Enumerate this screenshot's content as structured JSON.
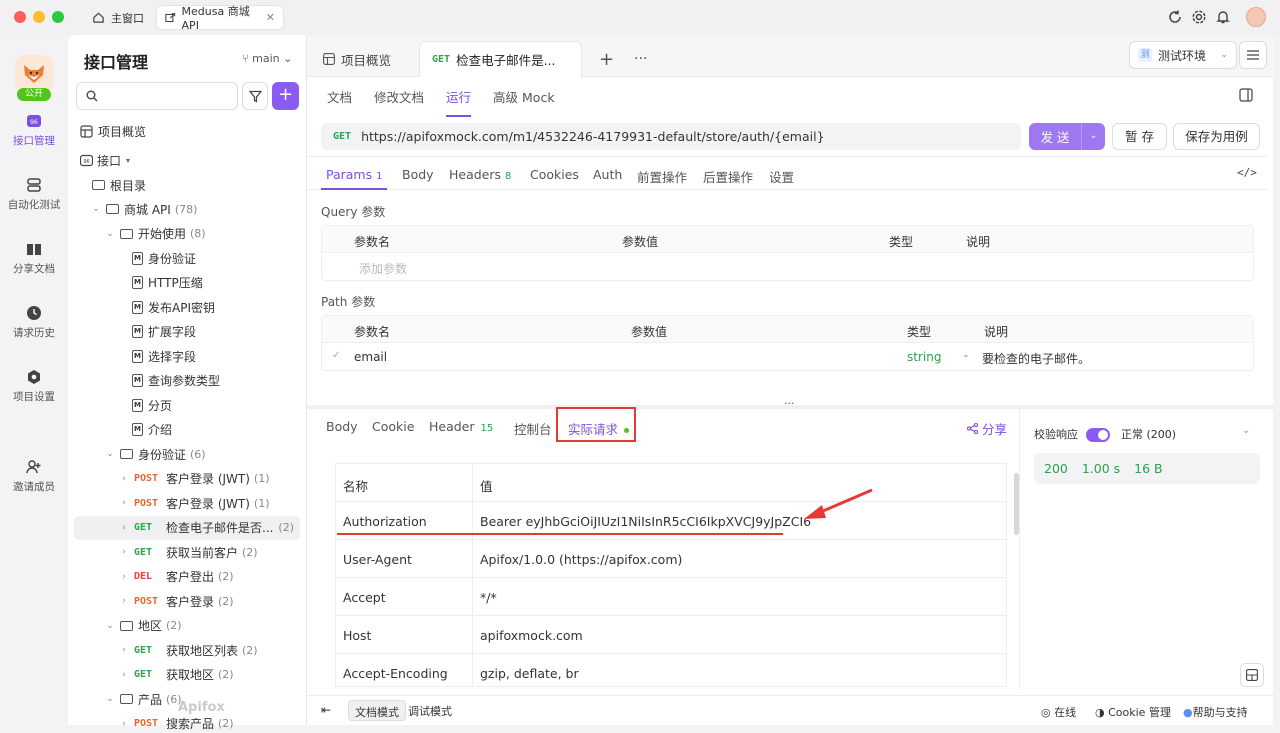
{
  "titlebar": {
    "home_tab": "主窗口",
    "project_tab": "Medusa 商城 API",
    "close": "✕"
  },
  "rail": {
    "public_badge": "公开",
    "items": [
      {
        "label": "接口管理",
        "icon": "api-icon"
      },
      {
        "label": "自动化测试",
        "icon": "automation-icon"
      },
      {
        "label": "分享文档",
        "icon": "book-icon"
      },
      {
        "label": "请求历史",
        "icon": "clock-icon"
      },
      {
        "label": "项目设置",
        "icon": "settings-icon"
      },
      {
        "label": "邀请成员",
        "icon": "invite-icon"
      }
    ]
  },
  "left": {
    "title": "接口管理",
    "branch": "main",
    "search_placeholder": "",
    "add": "+",
    "overview": "项目概览",
    "root_group": "接口",
    "root_dir": "根目录",
    "watermark": "Apifox",
    "tree": [
      {
        "label": "商城 API",
        "count": "(78)",
        "type": "folder",
        "depth": 1
      },
      {
        "label": "开始使用",
        "count": "(8)",
        "type": "folder",
        "depth": 2
      },
      {
        "label": "身份验证",
        "type": "doc",
        "depth": 3
      },
      {
        "label": "HTTP压缩",
        "type": "doc",
        "depth": 3
      },
      {
        "label": "发布API密钥",
        "type": "doc",
        "depth": 3
      },
      {
        "label": "扩展字段",
        "type": "doc",
        "depth": 3
      },
      {
        "label": "选择字段",
        "type": "doc",
        "depth": 3
      },
      {
        "label": "查询参数类型",
        "type": "doc",
        "depth": 3
      },
      {
        "label": "分页",
        "type": "doc",
        "depth": 3
      },
      {
        "label": "介绍",
        "type": "doc",
        "depth": 3
      },
      {
        "label": "身份验证",
        "count": "(6)",
        "type": "folder",
        "depth": 2
      },
      {
        "method": "POST",
        "label": "客户登录 (JWT)",
        "count": "(1)",
        "type": "api",
        "depth": 3
      },
      {
        "method": "POST",
        "label": "客户登录 (JWT)",
        "count": "(1)",
        "type": "api",
        "depth": 3
      },
      {
        "method": "GET",
        "label": "检查电子邮件是否...",
        "count": "(2)",
        "type": "api",
        "depth": 3,
        "selected": true
      },
      {
        "method": "GET",
        "label": "获取当前客户",
        "count": "(2)",
        "type": "api",
        "depth": 3
      },
      {
        "method": "DEL",
        "label": "客户登出",
        "count": "(2)",
        "type": "api",
        "depth": 3
      },
      {
        "method": "POST",
        "label": "客户登录",
        "count": "(2)",
        "type": "api",
        "depth": 3
      },
      {
        "label": "地区",
        "count": "(2)",
        "type": "folder",
        "depth": 2
      },
      {
        "method": "GET",
        "label": "获取地区列表",
        "count": "(2)",
        "type": "api",
        "depth": 3
      },
      {
        "method": "GET",
        "label": "获取地区",
        "count": "(2)",
        "type": "api",
        "depth": 3
      },
      {
        "label": "产品",
        "count": "(6)",
        "type": "folder",
        "depth": 2
      },
      {
        "method": "POST",
        "label": "搜索产品",
        "count": "(2)",
        "type": "api",
        "depth": 3
      }
    ]
  },
  "main": {
    "tabs": {
      "overview": "项目概览",
      "current_method": "GET",
      "current": "检查电子邮件是...",
      "add": "+",
      "more": "···"
    },
    "env": {
      "badge": "测",
      "label": "测试环境"
    },
    "subtabs": [
      "文档",
      "修改文档",
      "运行",
      "高级 Mock"
    ],
    "active_subtab": "运行",
    "request": {
      "method": "GET",
      "url": "https://apifoxmock.com/m1/4532246-4179931-default/store/auth/{email}",
      "send": "发 送",
      "save_draft": "暂 存",
      "save_case": "保存为用例"
    },
    "param_tabs": [
      {
        "label": "Params",
        "count": "1"
      },
      {
        "label": "Body",
        "count": ""
      },
      {
        "label": "Headers",
        "count": "8"
      },
      {
        "label": "Cookies",
        "count": ""
      },
      {
        "label": "Auth",
        "count": ""
      },
      {
        "label": "前置操作",
        "count": ""
      },
      {
        "label": "后置操作",
        "count": ""
      },
      {
        "label": "设置",
        "count": ""
      }
    ],
    "query": {
      "title": "Query 参数",
      "headers": [
        "参数名",
        "参数值",
        "类型",
        "说明"
      ],
      "add_placeholder": "添加参数"
    },
    "path": {
      "title": "Path 参数",
      "headers": [
        "参数名",
        "参数值",
        "类型",
        "说明"
      ],
      "rows": [
        {
          "name": "email",
          "value": "",
          "type": "string",
          "desc": "要检查的电子邮件。"
        }
      ]
    },
    "resp_tabs": [
      {
        "label": "Body",
        "count": ""
      },
      {
        "label": "Cookie",
        "count": ""
      },
      {
        "label": "Header",
        "count": "15"
      },
      {
        "label": "控制台",
        "count": ""
      },
      {
        "label": "实际请求",
        "count": ""
      }
    ],
    "share": "分享",
    "headers_table": {
      "cols": [
        "名称",
        "值"
      ],
      "rows": [
        {
          "k": "Authorization",
          "v": "Bearer eyJhbGciOiJIUzI1NiIsInR5cCI6IkpXVCJ9yJpZCI6"
        },
        {
          "k": "User-Agent",
          "v": "Apifox/1.0.0 (https://apifox.com)"
        },
        {
          "k": "Accept",
          "v": "*/*"
        },
        {
          "k": "Host",
          "v": "apifoxmock.com"
        },
        {
          "k": "Accept-Encoding",
          "v": "gzip, deflate, br"
        }
      ]
    },
    "validate": {
      "label": "校验响应",
      "status": "正常 (200)",
      "enabled": true
    },
    "stats": {
      "code": "200",
      "time": "1.00 s",
      "size": "16 B"
    },
    "footer": {
      "doc_mode": "文档模式",
      "debug_mode": "调试模式",
      "online": "在线",
      "cookie": "Cookie 管理",
      "help": "帮助与支持"
    }
  }
}
